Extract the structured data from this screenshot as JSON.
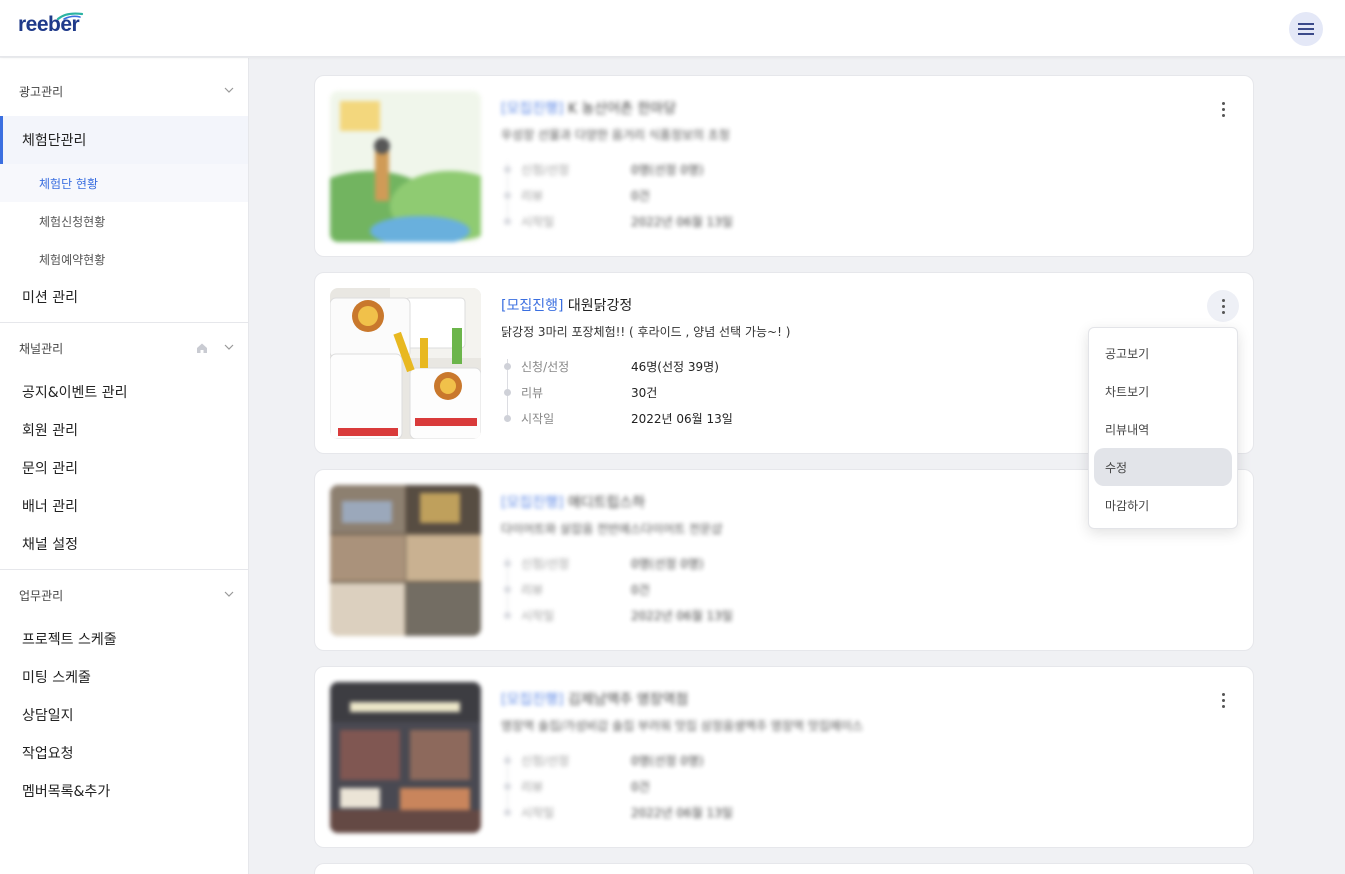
{
  "header": {
    "logo": "reeber",
    "menu_icon": "hamburger-icon"
  },
  "sidebar": {
    "sections": [
      {
        "label": "광고관리",
        "icon": "chevron-down-icon"
      },
      {
        "label": "채널관리",
        "icons": [
          "home-icon",
          "chevron-down-icon"
        ]
      },
      {
        "label": "업무관리",
        "icon": "chevron-down-icon"
      }
    ],
    "ad": {
      "experience_group": "체험단관리",
      "sub_items": [
        "체험단 현황",
        "체험신청현황",
        "체험예약현황"
      ],
      "mission": "미션 관리"
    },
    "channel": {
      "items": [
        "공지&이벤트 관리",
        "회원 관리",
        "문의 관리",
        "배너 관리",
        "채널 설정"
      ]
    },
    "work": {
      "items": [
        "프로젝트 스케줄",
        "미팅 스케줄",
        "상담일지",
        "작업요청",
        "멤버목록&추가"
      ]
    }
  },
  "cards": [
    {
      "status": "[모집진행]",
      "title": "K 농산어촌 한마당",
      "desc": "우성장 선물과 다양한 음거리 식품정보의 초청",
      "labels": [
        "신청/선정",
        "리뷰",
        "시작일"
      ],
      "values": [
        "0명(선정 0명)",
        "0건",
        "2022년 06월 13일"
      ]
    },
    {
      "status": "[모집진행]",
      "title": "대원닭강정",
      "desc": "닭강정 3마리 포장체험!! ( 후라이드 , 양념 선택 가능~! )",
      "labels": [
        "신청/선정",
        "리뷰",
        "시작일"
      ],
      "values": [
        "46명(선정 39명)",
        "30건",
        "2022년 06월 13일"
      ]
    },
    {
      "status": "[모집진행]",
      "title": "애디트립스하",
      "desc": "다이어트와 살잡음 전반에스다이어트 전문샵",
      "labels": [
        "신청/선정",
        "리뷰",
        "시작일"
      ],
      "values": [
        "0명(선정 0명)",
        "0건",
        "2022년 06월 13일"
      ]
    },
    {
      "status": "[모집진행]",
      "title": "김제남맥주 영장역점",
      "desc": "영장역 술집/가성비갑 술집 부러워 맛집 삼정음생맥주 영장역 맛집메이스",
      "labels": [
        "신청/선정",
        "리뷰",
        "시작일"
      ],
      "values": [
        "0명(선정 0명)",
        "0건",
        "2022년 06월 13일"
      ]
    }
  ],
  "dropdown": {
    "items": [
      "공고보기",
      "차트보기",
      "리뷰내역",
      "수정",
      "마감하기"
    ],
    "highlighted": "수정"
  },
  "colors": {
    "accent": "#3b6fe0",
    "logo": "#1f3a8a",
    "background": "#f0f1f4"
  }
}
